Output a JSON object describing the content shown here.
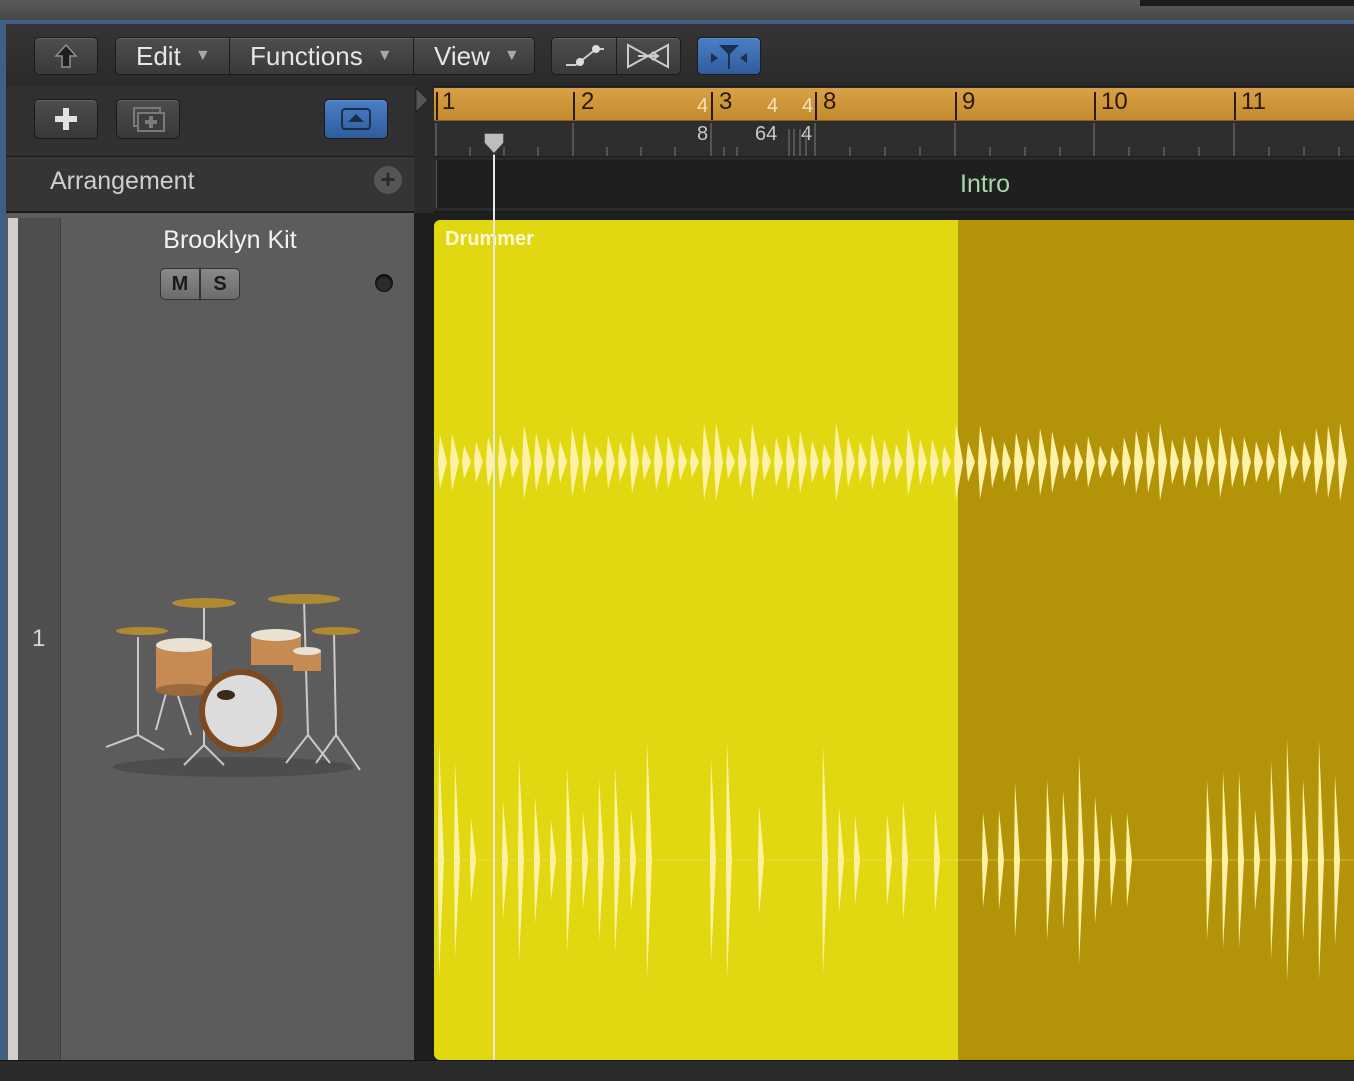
{
  "toolbar": {
    "back_icon": "up-arrow-icon",
    "menus": [
      {
        "label": "Edit"
      },
      {
        "label": "Functions"
      },
      {
        "label": "View"
      }
    ],
    "tool_icons": [
      "automation-curve-icon",
      "flex-icon",
      "catch-playhead-icon"
    ]
  },
  "header_buttons": {
    "add_icon": "plus-icon",
    "duplicate_icon": "duplicate-track-icon",
    "global_tracks_icon": "triangle-up-icon"
  },
  "arrangement": {
    "label": "Arrangement",
    "add_icon": "plus-circle-icon",
    "marker": "Intro"
  },
  "ruler": {
    "bars": [
      "1",
      "2",
      "3",
      "8",
      "9",
      "10",
      "11"
    ],
    "signatures_upper": [
      "4",
      "4",
      "4"
    ],
    "signatures_lower": [
      "8",
      "64",
      "4"
    ]
  },
  "track": {
    "number": "1",
    "name": "Brooklyn Kit",
    "mute_label": "M",
    "solo_label": "S",
    "instrument_icon": "drum-kit-icon"
  },
  "region": {
    "name": "Drummer",
    "color": "#e1d812",
    "color_dim": "#b39308"
  },
  "colors": {
    "accent_blue": "#3f6fb0",
    "ruler": "#d29a3f",
    "marker_text": "#a9d7a9"
  }
}
